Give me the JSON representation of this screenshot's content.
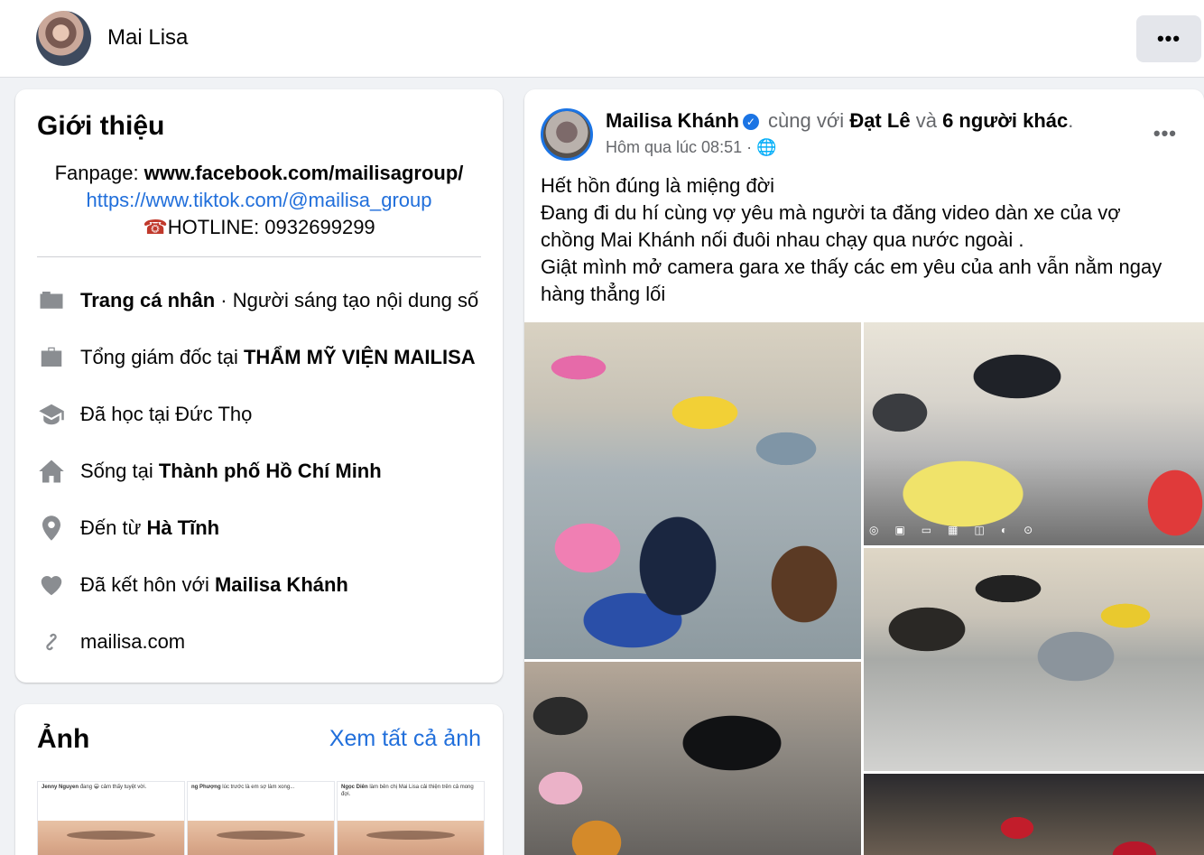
{
  "header": {
    "name": "Mai Lisa",
    "more_label": "•••"
  },
  "intro": {
    "title": "Giới thiệu",
    "fanpage_prefix": "Fanpage: ",
    "fanpage_url": "www.facebook.com/mailisagroup/",
    "tiktok_url": "https://www.tiktok.com/@mailisa_group",
    "hotline_icon": "☎",
    "hotline": "HOTLINE: 0932699299",
    "rows": [
      {
        "icon": "profile-icon",
        "bold": "Trang cá nhân",
        "rest": " · Người sáng tạo nội dung số"
      },
      {
        "icon": "briefcase-icon",
        "prefix": "Tổng giám đốc tại ",
        "bold": "THẨM MỸ VIỆN MAILISA"
      },
      {
        "icon": "graduation-cap-icon",
        "prefix": "Đã học tại Đức Thọ"
      },
      {
        "icon": "home-icon",
        "prefix": "Sống tại ",
        "bold": "Thành phố Hồ Chí Minh"
      },
      {
        "icon": "location-pin-icon",
        "prefix": "Đến từ ",
        "bold": "Hà Tĩnh"
      },
      {
        "icon": "heart-icon",
        "prefix": "Đã kết hôn với ",
        "bold": "Mailisa Khánh"
      },
      {
        "icon": "link-icon",
        "prefix": "mailisa.com"
      }
    ]
  },
  "photos": {
    "title": "Ảnh",
    "see_all": "Xem tất cả ảnh",
    "thumbs": [
      {
        "author": "Jenny Nguyen",
        "caption": "đang 😀 cảm thấy tuyệt vời."
      },
      {
        "author": "ng Phượng",
        "caption": "lúc trước là em sợ làm xong..."
      },
      {
        "author": "Ngọc Diên",
        "caption": "làm bên chị Mai Lisa cải thiện trên cả mong đợi."
      }
    ]
  },
  "post": {
    "author": "Mailisa Khánh",
    "with_text": "cùng với",
    "tagged_1": "Đạt Lê",
    "and_text": "và",
    "tagged_others": "6 người khác",
    "time": "Hôm qua lúc 08:51 ·",
    "privacy_icon": "globe-icon",
    "more_label": "•••",
    "body": [
      "Hết hồn đúng là miệng đời",
      "Đang đi du hí cùng vợ yêu mà người ta đăng video dàn xe của vợ",
      "chồng Mai Khánh nối đuôi nhau chạy qua nước ngoài .",
      "Giật mình mở camera gara xe thấy các em yêu của anh vẫn nằm ngay",
      "hàng thẳng lối"
    ],
    "photo_names": [
      "garage-photo-1",
      "garage-photo-2",
      "garage-photo-3",
      "garage-photo-4",
      "garage-photo-5"
    ]
  }
}
